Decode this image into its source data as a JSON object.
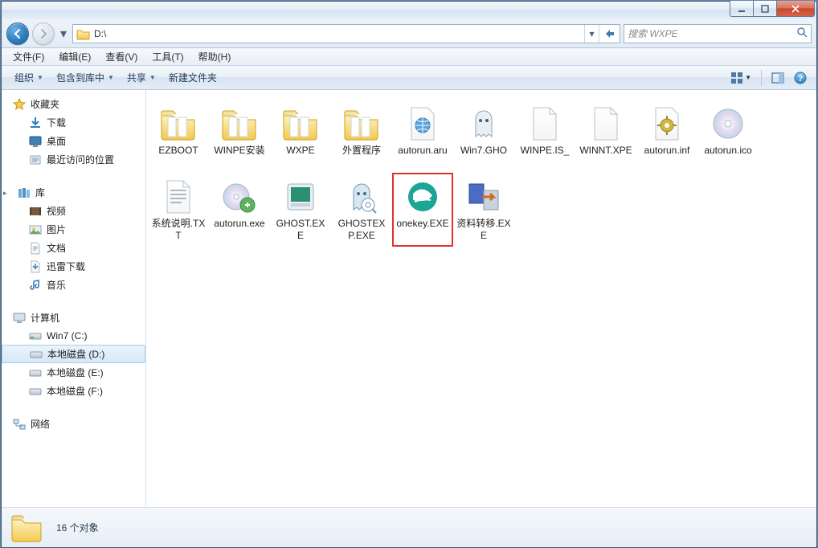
{
  "title_bar": {
    "min": "–",
    "max": "□",
    "close": "✕"
  },
  "nav": {
    "path": "D:\\",
    "search_placeholder": "搜索 WXPE"
  },
  "menu": {
    "file": "文件(F)",
    "edit": "编辑(E)",
    "view": "查看(V)",
    "tools": "工具(T)",
    "help": "帮助(H)"
  },
  "toolbar": {
    "organize": "组织",
    "include": "包含到库中",
    "share": "共享",
    "newfolder": "新建文件夹"
  },
  "sidebar": {
    "favorites": {
      "label": "收藏夹",
      "items": [
        "下载",
        "桌面",
        "最近访问的位置"
      ]
    },
    "libraries": {
      "label": "库",
      "items": [
        "视频",
        "图片",
        "文档",
        "迅雷下载",
        "音乐"
      ]
    },
    "computer": {
      "label": "计算机",
      "items": [
        "Win7 (C:)",
        "本地磁盘 (D:)",
        "本地磁盘 (E:)",
        "本地磁盘 (F:)"
      ],
      "selected_index": 1
    },
    "network": {
      "label": "网络"
    }
  },
  "files": [
    {
      "name": "EZBOOT",
      "kind": "folder"
    },
    {
      "name": "WINPE安装",
      "kind": "folder"
    },
    {
      "name": "WXPE",
      "kind": "folder"
    },
    {
      "name": "外置程序",
      "kind": "folder"
    },
    {
      "name": "autorun.aru",
      "kind": "htmlfile"
    },
    {
      "name": "Win7.GHO",
      "kind": "ghost"
    },
    {
      "name": "WINPE.IS_",
      "kind": "file"
    },
    {
      "name": "WINNT.XPE",
      "kind": "file"
    },
    {
      "name": "autorun.inf",
      "kind": "gear"
    },
    {
      "name": "autorun.ico",
      "kind": "disc"
    },
    {
      "name": "系统说明.TXT",
      "kind": "text"
    },
    {
      "name": "autorun.exe",
      "kind": "exe-disc"
    },
    {
      "name": "GHOST.EXE",
      "kind": "exe-green"
    },
    {
      "name": "GHOSTEXP.EXE",
      "kind": "exe-ghost"
    },
    {
      "name": "onekey.EXE",
      "kind": "exe-teal",
      "highlight": true
    },
    {
      "name": "资料转移.EXE",
      "kind": "exe-transfer"
    }
  ],
  "status": {
    "count_text": "16 个对象"
  }
}
